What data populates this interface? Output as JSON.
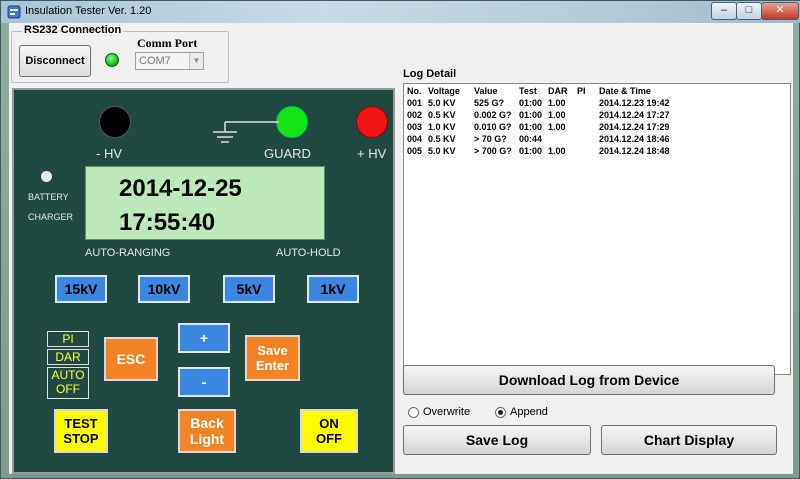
{
  "window": {
    "title": "Insulation Tester Ver. 1.20",
    "minimize": "–",
    "maximize": "□",
    "close": "✕"
  },
  "connection": {
    "group_title": "RS232 Connection",
    "button": "Disconnect",
    "comm_label": "Comm Port",
    "comm_value": "COM7",
    "status_color": "#19c419"
  },
  "panel": {
    "neg_hv": "- HV",
    "guard": "GUARD",
    "pos_hv": "+ HV",
    "battery": "BATTERY",
    "charger": "CHARGER",
    "lcd_date": "2014-12-25",
    "lcd_time": "17:55:40",
    "auto_ranging": "AUTO-RANGING",
    "auto_hold": "AUTO-HOLD",
    "ranges": [
      "15kV",
      "10kV",
      "5kV",
      "1kV"
    ],
    "indicators": [
      "PI",
      "DAR",
      "AUTO\nOFF"
    ],
    "esc": "ESC",
    "plus": "+",
    "minus": "-",
    "save_enter_1": "Save",
    "save_enter_2": "Enter",
    "test_stop_1": "TEST",
    "test_stop_2": "STOP",
    "back_light_1": "Back",
    "back_light_2": "Light",
    "on_off_1": "ON",
    "on_off_2": "OFF"
  },
  "log": {
    "title": "Log Detail",
    "headers": [
      "No.",
      "Voltage",
      "Value",
      "Test",
      "DAR",
      "PI",
      "Date & Time"
    ],
    "rows": [
      [
        "001",
        "5.0 KV",
        "525 G?",
        "01:00",
        "1.00",
        "",
        "2014.12.23 19:42"
      ],
      [
        "002",
        "0.5 KV",
        "0.002 G?",
        "01:00",
        "1.00",
        "",
        "2014.12.24 17:27"
      ],
      [
        "003",
        "1.0 KV",
        "0.010 G?",
        "01:00",
        "1.00",
        "",
        "2014.12.24 17:29"
      ],
      [
        "004",
        "0.5 KV",
        ">  70 G?",
        "00:44",
        "",
        "",
        "2014.12.24 18:46"
      ],
      [
        "005",
        "5.0 KV",
        "> 700 G?",
        "01:00",
        "1.00",
        "",
        "2014.12.24 18:48"
      ]
    ]
  },
  "actions": {
    "download": "Download Log from Device",
    "overwrite": "Overwrite",
    "append": "Append",
    "append_selected": true,
    "save_log": "Save Log",
    "chart_display": "Chart Display"
  }
}
